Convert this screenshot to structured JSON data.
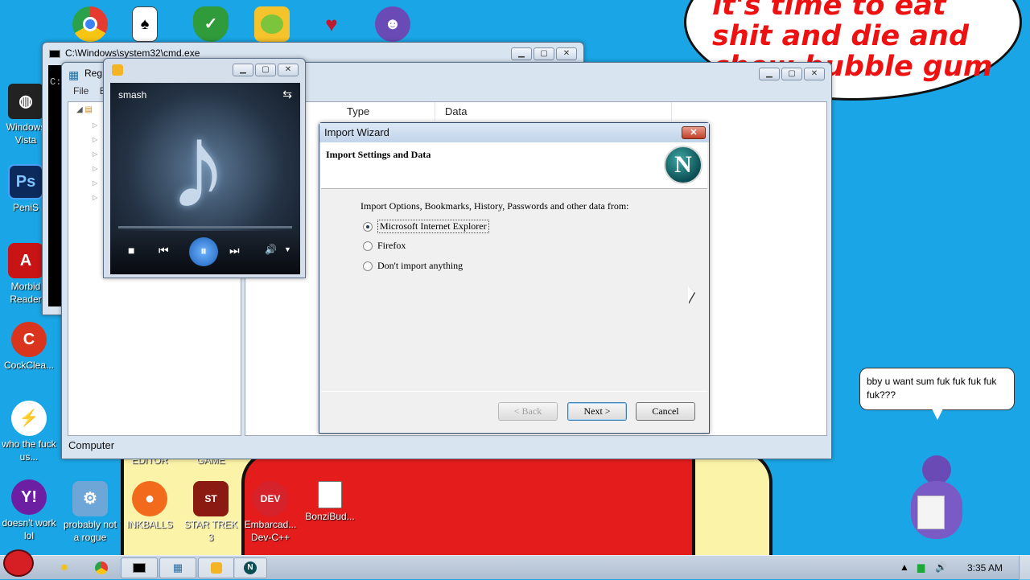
{
  "wallpaper": {
    "speech_big": "it's time to eat shit and die and chew bubble gum",
    "speech_small": "bby u want sum fuk fuk fuk fuk fuk???"
  },
  "desktop_icons": [
    {
      "label": "",
      "icon": "chrome-icon"
    },
    {
      "label": "",
      "icon": "solitaire-icon"
    },
    {
      "label": "",
      "icon": "shield-icon"
    },
    {
      "label": "",
      "icon": "bad-piggies-icon"
    },
    {
      "label": "",
      "icon": "game-icon"
    },
    {
      "label": "",
      "icon": "bonzi-icon"
    },
    {
      "label": "Windows Vista",
      "icon": "vista-icon"
    },
    {
      "label": "PeniS",
      "icon": "photoshop-icon"
    },
    {
      "label": "Morbid Reader",
      "icon": "pdf-reader-icon"
    },
    {
      "label": "CockClea...",
      "icon": "ccleaner-icon"
    },
    {
      "label": "who the fuck us...",
      "icon": "winamp-icon"
    },
    {
      "label": "doesn't work lol",
      "icon": "yahoo-icon"
    },
    {
      "label": "probably not a rogue",
      "icon": "antivirus-icon"
    },
    {
      "label": "INKBALLS",
      "icon": "inkball-icon"
    },
    {
      "label": "STAR TREK 3",
      "icon": "star-trek-icon"
    },
    {
      "label": "Embarcad... Dev-C++",
      "icon": "devcpp-icon"
    },
    {
      "label": "BonziBud...",
      "icon": "folder-icon"
    },
    {
      "label": "EDITOR",
      "icon": "editor-label"
    },
    {
      "label": "GAME",
      "icon": "game-label"
    }
  ],
  "cmd": {
    "title": "C:\\Windows\\system32\\cmd.exe",
    "prompt": "C:"
  },
  "regedit": {
    "title": "Reg",
    "menu": [
      "File",
      "E"
    ],
    "columns": [
      "Type",
      "Data"
    ],
    "status": "Computer"
  },
  "player": {
    "track": "smash",
    "buttons": {
      "stop": "■",
      "prev": "⏮",
      "pause": "⏸",
      "next": "⏭",
      "volume": "🔊"
    }
  },
  "wizard": {
    "title": "Import Wizard",
    "header": "Import Settings and Data",
    "logo": "N",
    "prompt": "Import Options, Bookmarks, History, Passwords and other data from:",
    "options": [
      "Microsoft Internet Explorer",
      "Firefox",
      "Don't import anything"
    ],
    "selected": 0,
    "back_label": "< Back",
    "next_label": "Next >",
    "cancel_label": "Cancel"
  },
  "taskbar": {
    "clock": "3:35 AM"
  }
}
